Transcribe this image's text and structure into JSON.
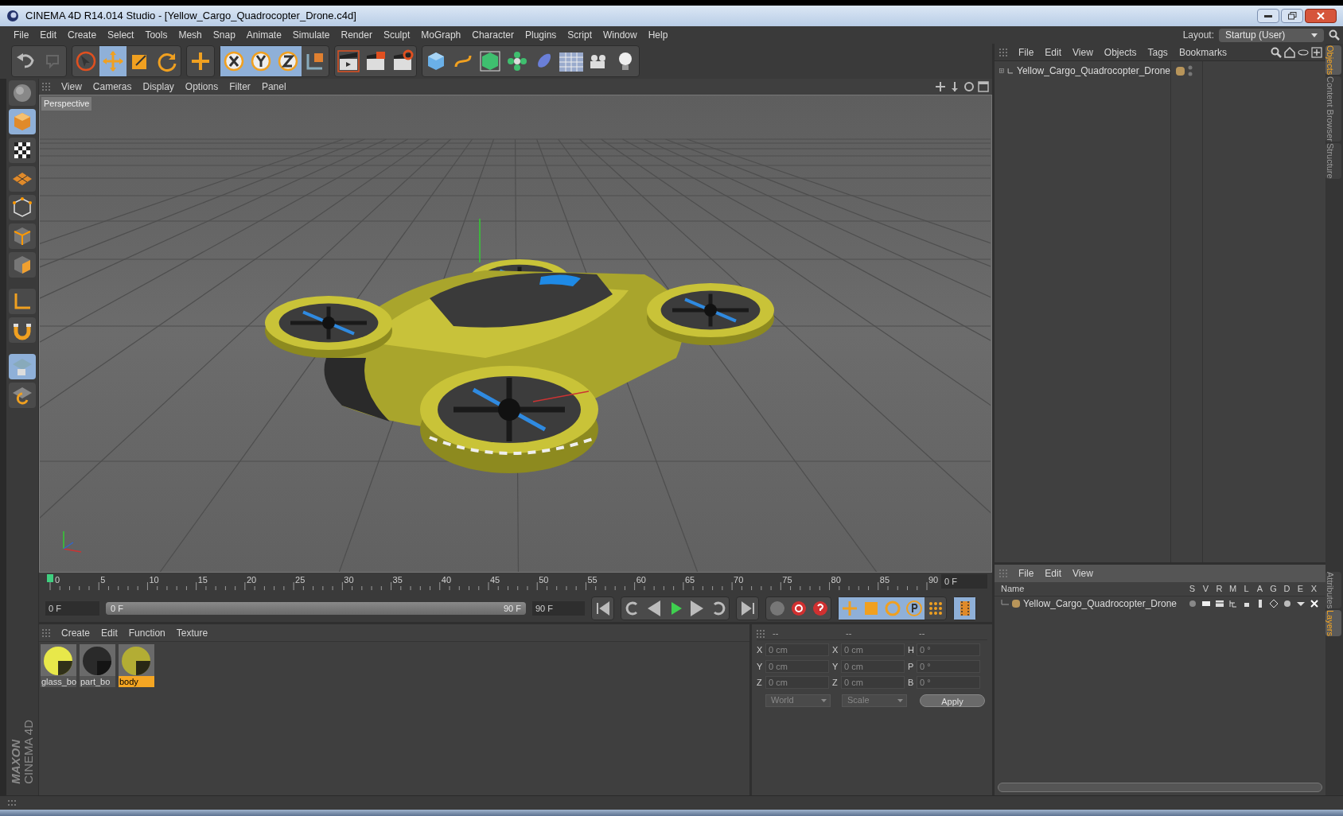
{
  "window": {
    "title": "CINEMA 4D R14.014 Studio - [Yellow_Cargo_Quadrocopter_Drone.c4d]"
  },
  "menu_bar": [
    "File",
    "Edit",
    "Create",
    "Select",
    "Tools",
    "Mesh",
    "Snap",
    "Animate",
    "Simulate",
    "Render",
    "Sculpt",
    "MoGraph",
    "Character",
    "Plugins",
    "Script",
    "Window",
    "Help"
  ],
  "layout": {
    "label": "Layout:",
    "value": "Startup (User)"
  },
  "viewport": {
    "menu": [
      "View",
      "Cameras",
      "Display",
      "Options",
      "Filter",
      "Panel"
    ],
    "camera_label": "Perspective"
  },
  "timeline": {
    "ticks": [
      "0",
      "5",
      "10",
      "15",
      "20",
      "25",
      "30",
      "35",
      "40",
      "45",
      "50",
      "55",
      "60",
      "65",
      "70",
      "75",
      "80",
      "85",
      "90"
    ],
    "current_frame": "0 F",
    "start_field": "0 F",
    "range": {
      "start": "0 F",
      "end": "90 F",
      "level": 1
    },
    "end_field": "90 F"
  },
  "materials": {
    "menu": [
      "Create",
      "Edit",
      "Function",
      "Texture"
    ],
    "items": [
      {
        "name": "glass_bo",
        "color": "#e8e84a",
        "selected": false
      },
      {
        "name": "part_bo",
        "color": "#2a2a2a",
        "selected": false
      },
      {
        "name": "body",
        "color": "#b3ad34",
        "selected": true
      }
    ]
  },
  "coordinates": {
    "headers": [
      "--",
      "--",
      "--"
    ],
    "rows": [
      {
        "a": "X",
        "av": "0 cm",
        "b": "X",
        "bv": "0 cm",
        "c": "H",
        "cv": "0 °"
      },
      {
        "a": "Y",
        "av": "0 cm",
        "b": "Y",
        "bv": "0 cm",
        "c": "P",
        "cv": "0 °"
      },
      {
        "a": "Z",
        "av": "0 cm",
        "b": "Z",
        "bv": "0 cm",
        "c": "B",
        "cv": "0 °"
      }
    ],
    "dropdowns": [
      "World",
      "Scale"
    ],
    "apply": "Apply"
  },
  "objects_panel": {
    "menu": [
      "File",
      "Edit",
      "View",
      "Objects",
      "Tags",
      "Bookmarks"
    ],
    "objects": [
      {
        "name": "Yellow_Cargo_Quadrocopter_Drone",
        "color": "#b8955a"
      }
    ]
  },
  "layers_panel": {
    "menu": [
      "File",
      "Edit",
      "View"
    ],
    "columns": [
      "Name",
      "S",
      "V",
      "R",
      "M",
      "L",
      "A",
      "G",
      "D",
      "E",
      "X"
    ],
    "rows": [
      {
        "name": "Yellow_Cargo_Quadrocopter_Drone",
        "color": "#b8955a"
      }
    ]
  },
  "side_tabs_top": [
    {
      "label": "Objects",
      "selected": true
    },
    {
      "label": "Content Browser",
      "selected": false
    },
    {
      "label": "Structure",
      "selected": false
    }
  ],
  "side_tabs_bottom": [
    {
      "label": "Attributes",
      "selected": false
    },
    {
      "label": "Layers",
      "selected": true
    }
  ],
  "brand": [
    "MAXON",
    "CINEMA 4D"
  ]
}
